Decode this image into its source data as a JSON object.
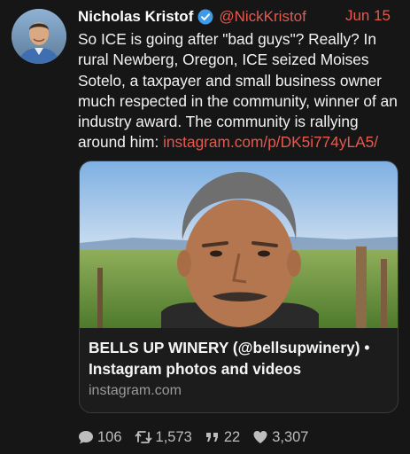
{
  "tweet": {
    "author": {
      "display_name": "Nicholas Kristof",
      "handle": "@NickKristof",
      "verified": true
    },
    "date": "Jun 15",
    "text": "So ICE is going after \"bad guys\"? Really? In rural Newberg, Oregon, ICE seized Moises Sotelo, a taxpayer and small business owner much respected in the community, winner of an industry award. The community is rallying around him: ",
    "link_text": "instagram.com/p/DK5i774yLA5/",
    "card": {
      "title": "BELLS UP WINERY (@bellsupwinery) • Instagram photos and videos",
      "domain": "instagram.com"
    },
    "stats": {
      "replies": "106",
      "retweets": "1,573",
      "quotes": "22",
      "likes": "3,307"
    },
    "icons": [
      "verified-badge-icon",
      "reply-icon",
      "retweet-icon",
      "quote-icon",
      "heart-icon"
    ],
    "colors": {
      "background": "#161616",
      "accent": "#e5594f",
      "text": "#f3f3f3",
      "muted": "#9a9a9a",
      "verified": "#3d9be9"
    }
  }
}
